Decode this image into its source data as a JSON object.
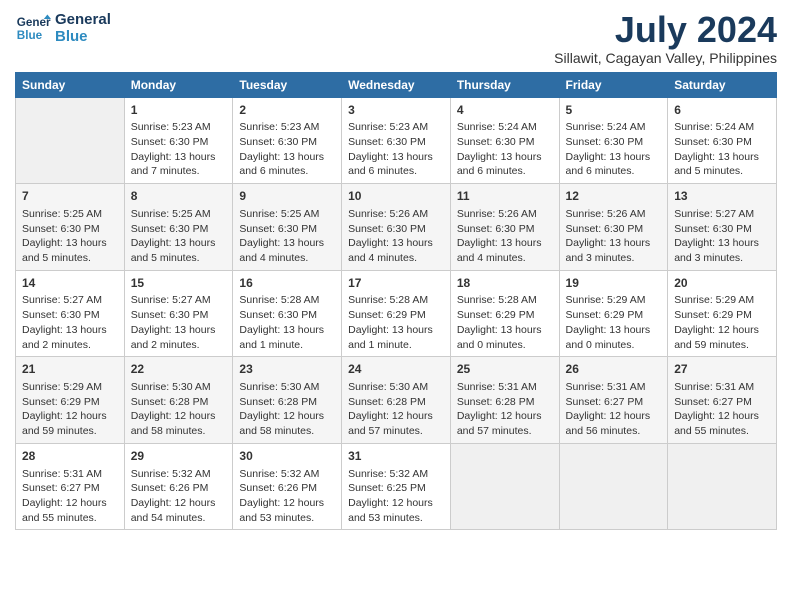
{
  "logo": {
    "line1": "General",
    "line2": "Blue"
  },
  "title": "July 2024",
  "subtitle": "Sillawit, Cagayan Valley, Philippines",
  "headers": [
    "Sunday",
    "Monday",
    "Tuesday",
    "Wednesday",
    "Thursday",
    "Friday",
    "Saturday"
  ],
  "weeks": [
    [
      {
        "day": "",
        "info": ""
      },
      {
        "day": "1",
        "info": "Sunrise: 5:23 AM\nSunset: 6:30 PM\nDaylight: 13 hours\nand 7 minutes."
      },
      {
        "day": "2",
        "info": "Sunrise: 5:23 AM\nSunset: 6:30 PM\nDaylight: 13 hours\nand 6 minutes."
      },
      {
        "day": "3",
        "info": "Sunrise: 5:23 AM\nSunset: 6:30 PM\nDaylight: 13 hours\nand 6 minutes."
      },
      {
        "day": "4",
        "info": "Sunrise: 5:24 AM\nSunset: 6:30 PM\nDaylight: 13 hours\nand 6 minutes."
      },
      {
        "day": "5",
        "info": "Sunrise: 5:24 AM\nSunset: 6:30 PM\nDaylight: 13 hours\nand 6 minutes."
      },
      {
        "day": "6",
        "info": "Sunrise: 5:24 AM\nSunset: 6:30 PM\nDaylight: 13 hours\nand 5 minutes."
      }
    ],
    [
      {
        "day": "7",
        "info": "Sunrise: 5:25 AM\nSunset: 6:30 PM\nDaylight: 13 hours\nand 5 minutes."
      },
      {
        "day": "8",
        "info": "Sunrise: 5:25 AM\nSunset: 6:30 PM\nDaylight: 13 hours\nand 5 minutes."
      },
      {
        "day": "9",
        "info": "Sunrise: 5:25 AM\nSunset: 6:30 PM\nDaylight: 13 hours\nand 4 minutes."
      },
      {
        "day": "10",
        "info": "Sunrise: 5:26 AM\nSunset: 6:30 PM\nDaylight: 13 hours\nand 4 minutes."
      },
      {
        "day": "11",
        "info": "Sunrise: 5:26 AM\nSunset: 6:30 PM\nDaylight: 13 hours\nand 4 minutes."
      },
      {
        "day": "12",
        "info": "Sunrise: 5:26 AM\nSunset: 6:30 PM\nDaylight: 13 hours\nand 3 minutes."
      },
      {
        "day": "13",
        "info": "Sunrise: 5:27 AM\nSunset: 6:30 PM\nDaylight: 13 hours\nand 3 minutes."
      }
    ],
    [
      {
        "day": "14",
        "info": "Sunrise: 5:27 AM\nSunset: 6:30 PM\nDaylight: 13 hours\nand 2 minutes."
      },
      {
        "day": "15",
        "info": "Sunrise: 5:27 AM\nSunset: 6:30 PM\nDaylight: 13 hours\nand 2 minutes."
      },
      {
        "day": "16",
        "info": "Sunrise: 5:28 AM\nSunset: 6:30 PM\nDaylight: 13 hours\nand 1 minute."
      },
      {
        "day": "17",
        "info": "Sunrise: 5:28 AM\nSunset: 6:29 PM\nDaylight: 13 hours\nand 1 minute."
      },
      {
        "day": "18",
        "info": "Sunrise: 5:28 AM\nSunset: 6:29 PM\nDaylight: 13 hours\nand 0 minutes."
      },
      {
        "day": "19",
        "info": "Sunrise: 5:29 AM\nSunset: 6:29 PM\nDaylight: 13 hours\nand 0 minutes."
      },
      {
        "day": "20",
        "info": "Sunrise: 5:29 AM\nSunset: 6:29 PM\nDaylight: 12 hours\nand 59 minutes."
      }
    ],
    [
      {
        "day": "21",
        "info": "Sunrise: 5:29 AM\nSunset: 6:29 PM\nDaylight: 12 hours\nand 59 minutes."
      },
      {
        "day": "22",
        "info": "Sunrise: 5:30 AM\nSunset: 6:28 PM\nDaylight: 12 hours\nand 58 minutes."
      },
      {
        "day": "23",
        "info": "Sunrise: 5:30 AM\nSunset: 6:28 PM\nDaylight: 12 hours\nand 58 minutes."
      },
      {
        "day": "24",
        "info": "Sunrise: 5:30 AM\nSunset: 6:28 PM\nDaylight: 12 hours\nand 57 minutes."
      },
      {
        "day": "25",
        "info": "Sunrise: 5:31 AM\nSunset: 6:28 PM\nDaylight: 12 hours\nand 57 minutes."
      },
      {
        "day": "26",
        "info": "Sunrise: 5:31 AM\nSunset: 6:27 PM\nDaylight: 12 hours\nand 56 minutes."
      },
      {
        "day": "27",
        "info": "Sunrise: 5:31 AM\nSunset: 6:27 PM\nDaylight: 12 hours\nand 55 minutes."
      }
    ],
    [
      {
        "day": "28",
        "info": "Sunrise: 5:31 AM\nSunset: 6:27 PM\nDaylight: 12 hours\nand 55 minutes."
      },
      {
        "day": "29",
        "info": "Sunrise: 5:32 AM\nSunset: 6:26 PM\nDaylight: 12 hours\nand 54 minutes."
      },
      {
        "day": "30",
        "info": "Sunrise: 5:32 AM\nSunset: 6:26 PM\nDaylight: 12 hours\nand 53 minutes."
      },
      {
        "day": "31",
        "info": "Sunrise: 5:32 AM\nSunset: 6:25 PM\nDaylight: 12 hours\nand 53 minutes."
      },
      {
        "day": "",
        "info": ""
      },
      {
        "day": "",
        "info": ""
      },
      {
        "day": "",
        "info": ""
      }
    ]
  ]
}
